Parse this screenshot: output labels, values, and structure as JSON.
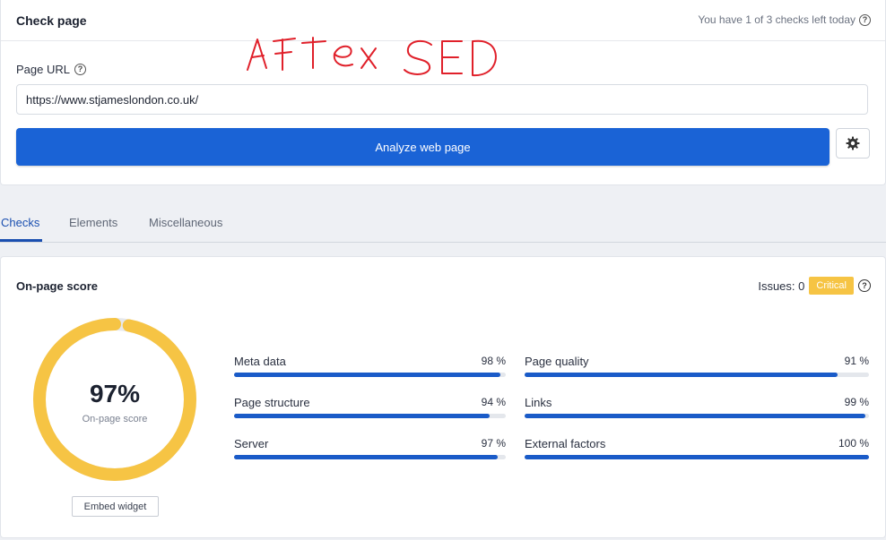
{
  "header": {
    "title": "Check page",
    "checks_left": "You have 1 of 3 checks left today"
  },
  "form": {
    "url_label": "Page URL",
    "url_value": "https://www.stjameslondon.co.uk/",
    "analyze_label": "Analyze web page"
  },
  "annotation": "After SEO",
  "tabs": [
    {
      "label": "Checks",
      "active": true
    },
    {
      "label": "Elements",
      "active": false
    },
    {
      "label": "Miscellaneous",
      "active": false
    }
  ],
  "score": {
    "title": "On-page score",
    "issues_label": "Issues: 0",
    "badge": "Critical",
    "value": "97%",
    "value_fraction": 0.97,
    "value_label": "On-page score",
    "embed_label": "Embed widget",
    "gauge_color": "#f6c444",
    "gauge_track_color": "#e6e8ec"
  },
  "metrics": [
    {
      "name": "Meta data",
      "value": "98 %",
      "fraction": 0.98
    },
    {
      "name": "Page quality",
      "value": "91 %",
      "fraction": 0.91
    },
    {
      "name": "Page structure",
      "value": "94 %",
      "fraction": 0.94
    },
    {
      "name": "Links",
      "value": "99 %",
      "fraction": 0.99
    },
    {
      "name": "Server",
      "value": "97 %",
      "fraction": 0.97
    },
    {
      "name": "External factors",
      "value": "100 %",
      "fraction": 1.0
    }
  ],
  "colors": {
    "accent": "#1a63d6",
    "bar": "#1a5bc8",
    "annotation": "#e0202a"
  }
}
